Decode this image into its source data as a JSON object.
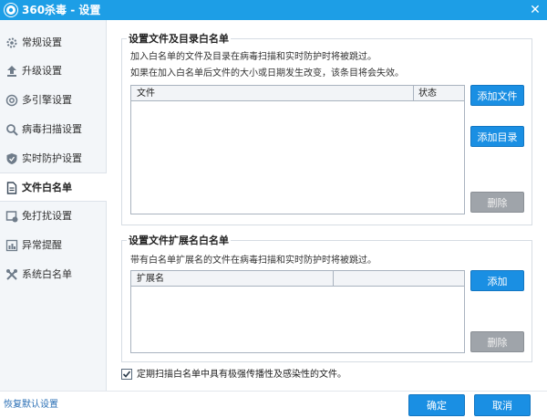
{
  "window": {
    "title": "360杀毒 - 设置",
    "logo_icon": "360-logo-icon",
    "close_icon": "close-icon",
    "close_glyph": "✕",
    "accent_color": "#1d9ee6"
  },
  "sidebar": {
    "items": [
      {
        "label": "常规设置",
        "icon": "gear-icon",
        "active": false
      },
      {
        "label": "升级设置",
        "icon": "upload-icon",
        "active": false
      },
      {
        "label": "多引擎设置",
        "icon": "engine-icon",
        "active": false
      },
      {
        "label": "病毒扫描设置",
        "icon": "search-icon",
        "active": false
      },
      {
        "label": "实时防护设置",
        "icon": "shield-icon",
        "active": false
      },
      {
        "label": "文件白名单",
        "icon": "document-icon",
        "active": true
      },
      {
        "label": "免打扰设置",
        "icon": "do-not-disturb-icon",
        "active": false
      },
      {
        "label": "异常提醒",
        "icon": "chart-icon",
        "active": false
      },
      {
        "label": "系统白名单",
        "icon": "tools-icon",
        "active": false
      }
    ]
  },
  "file_whitelist": {
    "title": "设置文件及目录白名单",
    "desc1": "加入白名单的文件及目录在病毒扫描和实时防护时将被跳过。",
    "desc2": "如果在加入白名单后文件的大小或日期发生改变，该条目将会失效。",
    "columns": [
      "文件",
      "状态"
    ],
    "add_file": "添加文件",
    "add_dir": "添加目录",
    "delete": "删除"
  },
  "ext_whitelist": {
    "title": "设置文件扩展名白名单",
    "desc": "带有白名单扩展名的文件在病毒扫描和实时防护时将被跳过。",
    "columns": [
      "扩展名",
      ""
    ],
    "add": "添加",
    "delete": "删除"
  },
  "option": {
    "label": "定期扫描白名单中具有极强传播性及感染性的文件。",
    "checked": true,
    "check_icon": "checkmark-icon"
  },
  "footer": {
    "restore_defaults": "恢复默认设置",
    "ok": "确定",
    "cancel": "取消"
  }
}
